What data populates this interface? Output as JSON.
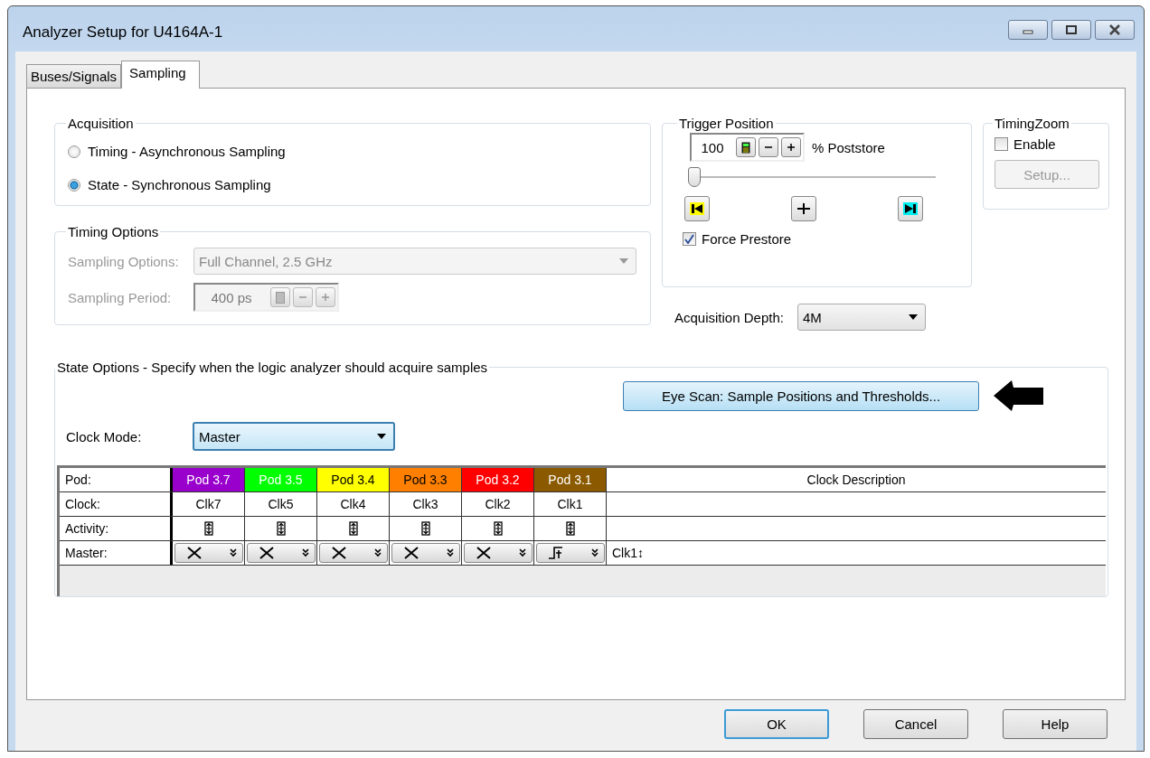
{
  "window": {
    "title": "Analyzer Setup for U4164A-1"
  },
  "tabs": [
    {
      "label": "Buses/Signals",
      "selected": false
    },
    {
      "label": "Sampling",
      "selected": true
    }
  ],
  "acquisition": {
    "title": "Acquisition",
    "options": [
      {
        "label": "Timing - Asynchronous Sampling",
        "selected": false
      },
      {
        "label": "State - Synchronous Sampling",
        "selected": true
      }
    ]
  },
  "timing_options": {
    "title": "Timing Options",
    "disabled": true,
    "sampling_options": {
      "label": "Sampling Options:",
      "value": "Full Channel, 2.5  GHz"
    },
    "sampling_period": {
      "label": "Sampling Period:",
      "value": "400 ps"
    }
  },
  "trigger_position": {
    "title": "Trigger Position",
    "value": "100",
    "unit": "% Poststore",
    "level": 0,
    "force_prestore": {
      "label": "Force Prestore",
      "checked": true
    }
  },
  "acquisition_depth": {
    "label": "Acquisition Depth:",
    "value": "4M"
  },
  "timing_zoom": {
    "title": "TimingZoom",
    "enable": {
      "label": "Enable",
      "checked": false
    },
    "setup_button": {
      "label": "Setup...",
      "disabled": true
    }
  },
  "state_options": {
    "title": "State Options - Specify when the logic analyzer should acquire samples",
    "eye_scan_button": "Eye Scan: Sample Positions and Thresholds...",
    "clock_mode": {
      "label": "Clock Mode:",
      "value": "Master"
    },
    "table": {
      "row_labels": [
        "Pod:",
        "Clock:",
        "Activity:",
        "Master:"
      ],
      "description_header": "Clock Description",
      "master_description": "Clk1↕",
      "pods": [
        {
          "name": "Pod 3.7",
          "color": "#9900cc",
          "clock": "Clk7",
          "kind": "none"
        },
        {
          "name": "Pod 3.5",
          "color": "#00ff00",
          "clock": "Clk5",
          "kind": "none"
        },
        {
          "name": "Pod 3.4",
          "color": "#ffff00",
          "clock": "Clk4",
          "kind": "none"
        },
        {
          "name": "Pod 3.3",
          "color": "#ff8000",
          "clock": "Clk3",
          "kind": "none"
        },
        {
          "name": "Pod 3.2",
          "color": "#ff0000",
          "clock": "Clk2",
          "kind": "none"
        },
        {
          "name": "Pod 3.1",
          "color": "#8b5a00",
          "clock": "Clk1",
          "kind": "rising"
        }
      ]
    }
  },
  "buttons": [
    "OK",
    "Cancel",
    "Help"
  ]
}
